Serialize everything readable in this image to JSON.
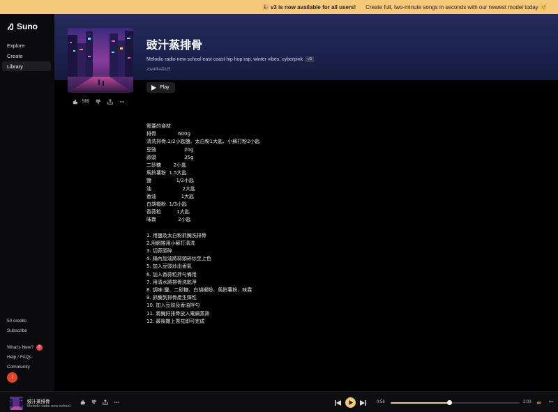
{
  "banner": {
    "headline": "🎉 v3 is now available for all users!",
    "message": "Create full, two-minute songs in seconds with our newest model today 🥳"
  },
  "app": {
    "logo_text": "Suno"
  },
  "sidebar": {
    "nav": [
      {
        "label": "Explore",
        "active": false
      },
      {
        "label": "Create",
        "active": false
      },
      {
        "label": "Library",
        "active": true
      }
    ],
    "credits": "50 credits",
    "subscribe": "Subscribe",
    "whats_new": "What's New?",
    "whats_new_count": "5",
    "help": "Help / FAQs",
    "community": "Community",
    "avatar_initial": "I"
  },
  "song": {
    "title": "豉汁蒸排骨",
    "style": "Melodic radio new school east coast hip hop rap, winter vibes, cyberpink",
    "version": "v3",
    "date": "2024年4月1日",
    "play_label": "Play",
    "likes": "569"
  },
  "lyrics": [
    "需要的食材",
    "排骨              600g",
    "清洗排骨:1/2小匙鹽、太白粉1大匙、小蘇打粉2小匙",
    "豆豉                  20g",
    "蒜頭                  35g",
    "二砂糖        2小匙",
    "馬鈴薯粉  1.5大匙",
    "鹽                1/2小匙",
    "油                    2大匙",
    "香油                1大匙",
    "白胡椒粉  1/3小匙",
    "香蒜粒          1大匙",
    "味霖              2小匙",
    "",
    "1. 用鹽及太白粉抓醃洗排骨",
    "2.用網捲用小蘇打清洗",
    "3. 切蒜頭碎",
    "4. 鍋內加油將蒜頭碎炒至上色",
    "5. 加入豆豉炒出香氣",
    "6. 加入香蒜粒拌勻備用",
    "7. 用清水將排骨洗乾淨",
    "8. 調味:鹽、二砂糖、白胡椒粉、馬鈴薯粉、味霖",
    "9. 抓醃到排骨產生彈性",
    "10. 加入豆豉及香油拌勻",
    "11. 將醃好排骨放入電鍋蒸熟",
    "12. 最後撒上蔥花即可完成"
  ],
  "player": {
    "title": "豉汁蒸排骨",
    "subtitle": "Melodic radio new school",
    "time_current": "0:56",
    "time_total": "2:03",
    "progress": 0.455,
    "loop_symbol": "∞"
  },
  "colors": {
    "accent": "#f5c97a",
    "hero": "#1c2350",
    "badge": "#e0454a"
  }
}
